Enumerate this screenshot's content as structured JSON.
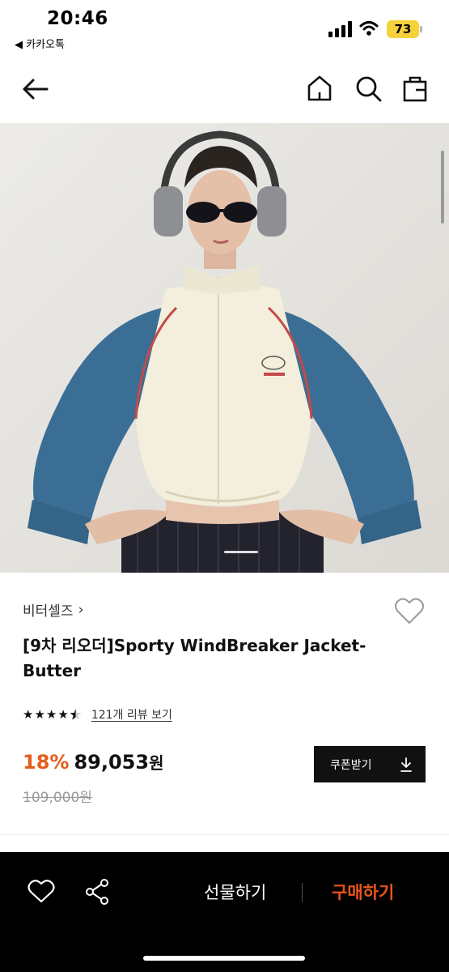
{
  "status_bar": {
    "time": "20:46",
    "back_app": "◀ 카카오톡",
    "battery": "73"
  },
  "nav": {
    "back_icon": "arrow-left-icon",
    "home_icon": "home-icon",
    "search_icon": "search-icon",
    "bag_icon": "shopping-bag-icon"
  },
  "product": {
    "brand": "비터셀즈",
    "brand_chevron": "›",
    "title": "[9차 리오더]Sporty WindBreaker Jacket-Butter",
    "rating": 4.5,
    "review_link": "121개 리뷰 보기",
    "discount": "18%",
    "sale_price": "89,053",
    "won": "원",
    "original_price": "109,000원",
    "coupon_label": "쿠폰받기"
  },
  "bottom_bar": {
    "gift_label": "선물하기",
    "buy_label": "구매하기"
  },
  "colors": {
    "accent": "#e65c1a",
    "buy": "#e8551c",
    "battery": "#f5d23a"
  }
}
